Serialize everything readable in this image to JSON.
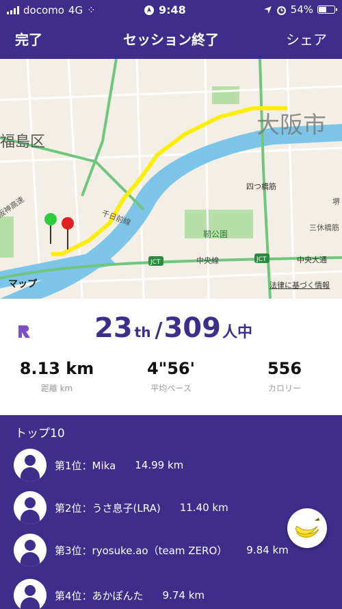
{
  "status": {
    "carrier": "docomo",
    "network": "4G",
    "time": "9:48",
    "battery": "54%",
    "battery_level": 0.54
  },
  "nav": {
    "done": "完了",
    "title": "セッション終了",
    "share": "シェア"
  },
  "map": {
    "labels": [
      "福島区",
      "大阪市",
      "千日前線",
      "四つ橋筋",
      "靭公園",
      "中央線",
      "中央大通",
      "JCT",
      "JCT",
      "阪神高速",
      "三休橋筋",
      "堺"
    ],
    "logo": "マップ",
    "legal": "法律に基づく情報"
  },
  "result": {
    "rank": "23",
    "rank_suffix": "th",
    "slash": "/",
    "total": "309",
    "total_unit": "人中",
    "stats": [
      {
        "value": "8.13 km",
        "label": "距離 km"
      },
      {
        "value": "4\"56'",
        "label": "平均ペース"
      },
      {
        "value": "556",
        "label": "カロリー"
      }
    ]
  },
  "leaders": {
    "heading": "トップ10",
    "rows": [
      {
        "name": "第1位：Mika",
        "dist": "14.99 km"
      },
      {
        "name": "第2位：うさ息子(LRA)",
        "dist": "11.40 km"
      },
      {
        "name": "第3位：ryosuke.ao（team ZERO）",
        "dist": "9.84 km"
      },
      {
        "name": "第4位：あかぽんた",
        "dist": "9.74 km"
      }
    ]
  },
  "colors": {
    "brand": "#3f2d8c",
    "route": "#ffee00",
    "water": "#7cc4e8",
    "park": "#b8dfa8"
  },
  "icons": [
    "signal-icon",
    "location-icon",
    "alarm-icon",
    "battery-icon",
    "apple-logo-icon",
    "app-logo-icon",
    "user-avatar-icon",
    "banana-icon"
  ]
}
